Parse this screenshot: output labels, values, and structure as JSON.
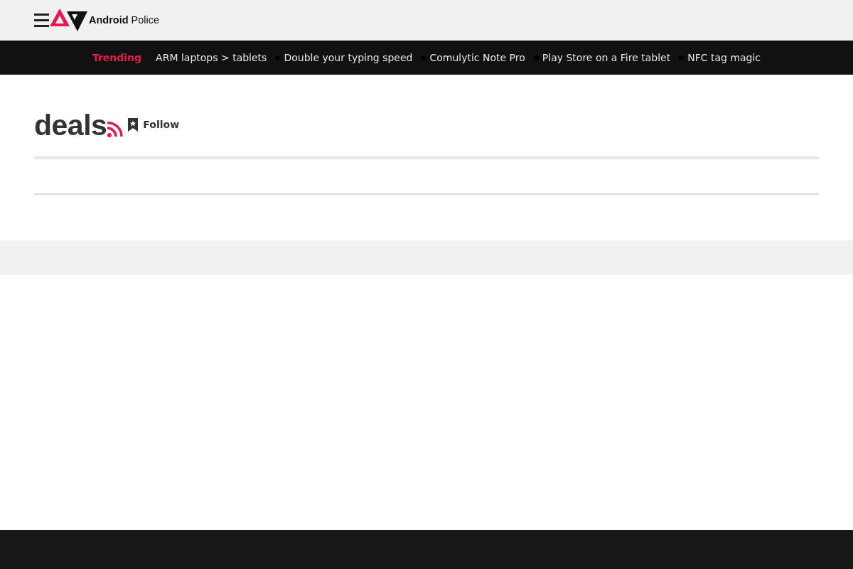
{
  "header": {
    "logo": {
      "brand_bold": "Android",
      "brand_light": "Police"
    }
  },
  "trending": {
    "label": "Trending",
    "items": [
      "ARM laptops > tablets",
      "Double your typing speed",
      "Comulytic Note Pro",
      "Play Store on a Fire tablet",
      "NFC tag magic"
    ]
  },
  "page_header": {
    "title": "deals",
    "follow_button": "Follow"
  }
}
